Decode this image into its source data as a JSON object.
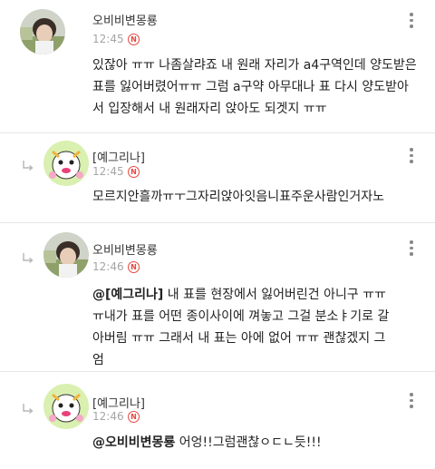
{
  "comments": [
    {
      "author": "오비비변몽룡",
      "time": "12:45",
      "new_badge": "N",
      "lines": [
        "있잖아 ㅠㅠ 나좀살랴죠 내 원래 자리가 a4구역인데 양도받은",
        "표를 잃어버렸어ㅠㅠ 그럼 a구약 아무대나 표 다시 양도받아",
        "서 입장해서 내 원래자리 앉아도 되겟지 ㅠㅠ"
      ]
    },
    {
      "author": "[예그리나]",
      "time": "12:45",
      "new_badge": "N",
      "lines": [
        "모르지안흘까ㅠㅜ그자리앉아잇음니표주운사람인거자노"
      ]
    },
    {
      "author": "오비비변몽룡",
      "time": "12:46",
      "new_badge": "N",
      "mention": "@[예그리나]",
      "lines": [
        " 내 표를 현장에서 잃어버린건 아니구 ㅠㅠ",
        "ㅠ내가 표를 어떤 종이사이에 껴놓고 그걸 분소ㅑ기로 갈",
        "아버림 ㅠㅠ 그래서 내 표는 아에 없어 ㅠㅠ 괜찮겠지 그",
        "엄"
      ]
    },
    {
      "author": "[예그리나]",
      "time": "12:46",
      "new_badge": "N",
      "mention": "@오비비변몽룡",
      "lines": [
        " 어엉!!그럼괜찮ㅇㄷㄴ듯!!!"
      ]
    }
  ],
  "icons": {
    "reply": "reply-arrow-icon",
    "more": "more-vertical-icon",
    "new": "new-badge-icon"
  },
  "colors": {
    "new_badge": "#e8473f",
    "time": "#a5a5a5",
    "separator": "#e6e6e6"
  }
}
